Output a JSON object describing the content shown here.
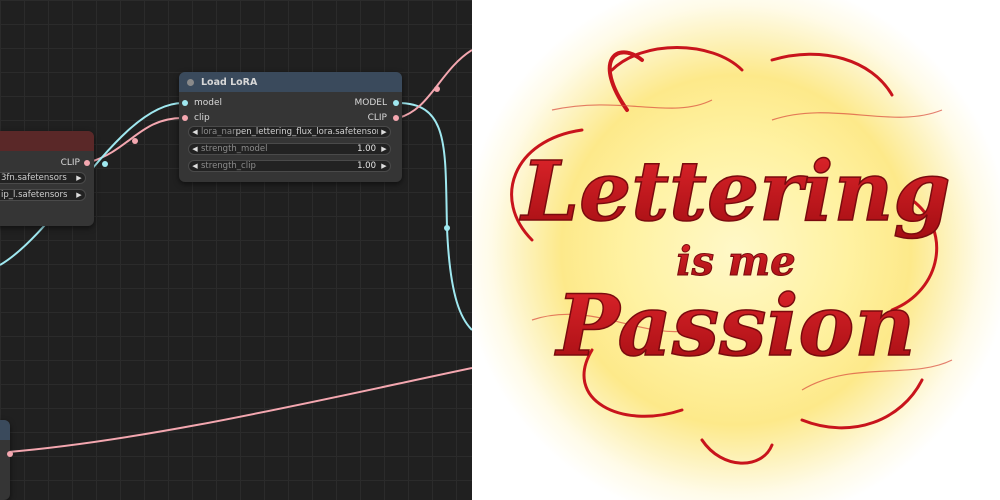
{
  "load_lora": {
    "title": "Load LoRA",
    "inputs": {
      "model": "model",
      "clip": "clip"
    },
    "outputs": {
      "model": "MODEL",
      "clip": "CLIP"
    },
    "lora_name_label": "lora_nar",
    "lora_name_value": "pen_lettering_flux_lora.safetensors",
    "strength_model": {
      "label": "strength_model",
      "value": "1.00"
    },
    "strength_clip": {
      "label": "strength_clip",
      "value": "1.00"
    }
  },
  "clip_loader": {
    "output_clip": "CLIP",
    "file1": "3fn.safetensors",
    "file2": "ip_l.safetensors"
  },
  "artwork": {
    "line1": "Lettering",
    "line2": "is me",
    "line3": "Passion"
  },
  "colors": {
    "canvas_bg": "#202020",
    "node_bg": "#353535",
    "lora_header": "#3a4a5c",
    "clip_header": "#5a2828",
    "model_wire": "#9fe8f0",
    "clip_wire": "#f4a7b0",
    "lettering_red": "#c8141c"
  }
}
